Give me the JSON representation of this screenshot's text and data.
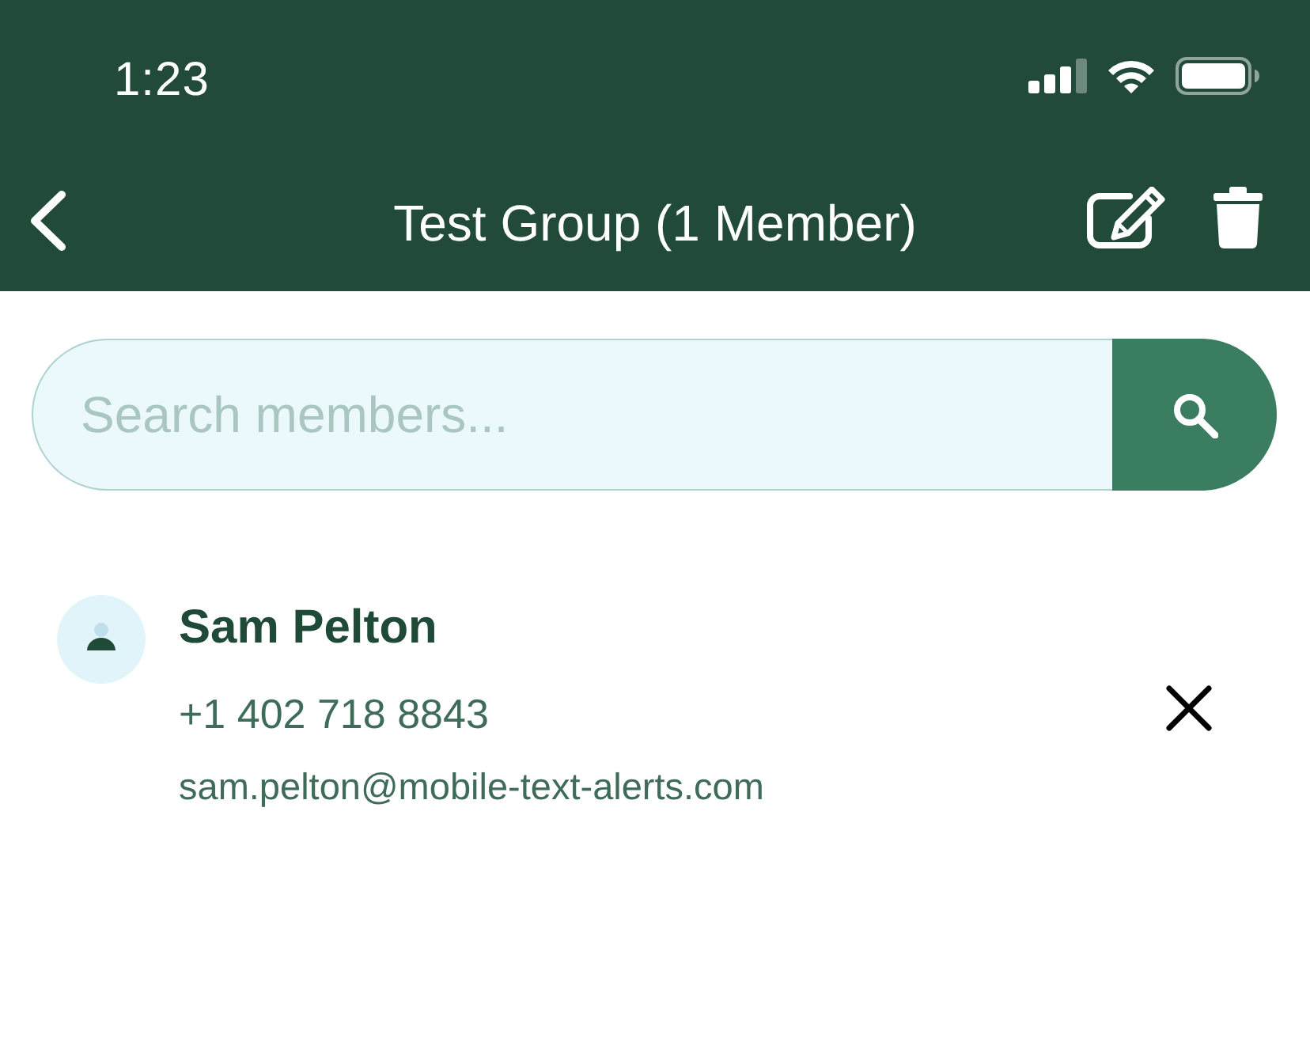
{
  "status_bar": {
    "time": "1:23"
  },
  "header": {
    "title": "Test Group (1 Member)"
  },
  "search": {
    "placeholder": "Search members..."
  },
  "members": [
    {
      "name": "Sam Pelton",
      "phone": "+1 402 718 8843",
      "email": "sam.pelton@mobile-text-alerts.com"
    }
  ]
}
